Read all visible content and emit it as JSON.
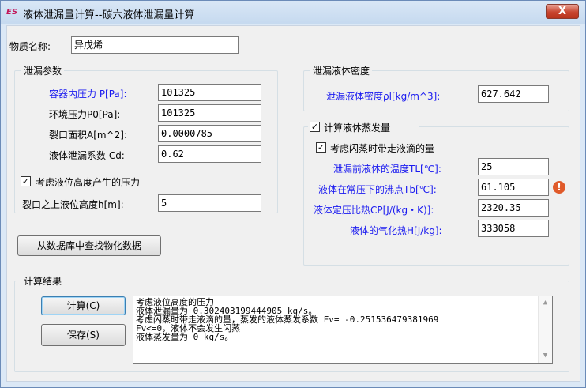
{
  "window": {
    "title": "液体泄漏量计算--碳六液体泄漏量计算",
    "icon_text": "ES",
    "close_label": "X"
  },
  "substance": {
    "label": "物质名称:",
    "value": "异戊烯"
  },
  "leak_params": {
    "title": "泄漏参数",
    "fields": [
      {
        "label": "容器内压力 P[Pa]:",
        "value": "101325"
      },
      {
        "label": "环境压力P0[Pa]:",
        "value": "101325"
      },
      {
        "label": "裂口面积A[m^2]:",
        "value": "0.0000785"
      },
      {
        "label": "液体泄漏系数  Cd:",
        "value": "0.62"
      }
    ],
    "consider_level_label": "考虑液位高度产生的压力",
    "consider_level_checked": true,
    "level_height_label": "裂口之上液位高度h[m]:",
    "level_height_value": "5"
  },
  "density": {
    "title": "泄漏液体密度",
    "label": "泄漏液体密度ρl[kg/m^3]:",
    "value": "627.642"
  },
  "evaporation": {
    "title": "计算液体蒸发量",
    "checked": true,
    "flash_label": "考虑闪蒸时带走液滴的量",
    "flash_checked": true,
    "fields": [
      {
        "label": "泄漏前液体的温度TL[℃]:",
        "value": "25"
      },
      {
        "label": "液体在常压下的沸点Tb[℃]:",
        "value": "61.105"
      },
      {
        "label": "液体定压比热CP[J/(kg・K)]:",
        "value": "2320.35"
      },
      {
        "label": "液体的气化热H[J/kg]:",
        "value": "333058"
      }
    ],
    "warning_icon": "!"
  },
  "db_button_label": "从数据库中查找物化数据",
  "results": {
    "title": "计算结果",
    "calc_button": "计算(C)",
    "save_button": "保存(S)",
    "lines": [
      "考虑液位高度的压力",
      "液体泄漏量为 0.302403199444905 kg/s。",
      "考虑闪蒸时带走液滴的量，蒸发的液体蒸发系数 Fv= -0.251536479381969",
      "Fv<=0，液体不会发生闪蒸",
      "液体蒸发量为 0 kg/s。"
    ]
  }
}
